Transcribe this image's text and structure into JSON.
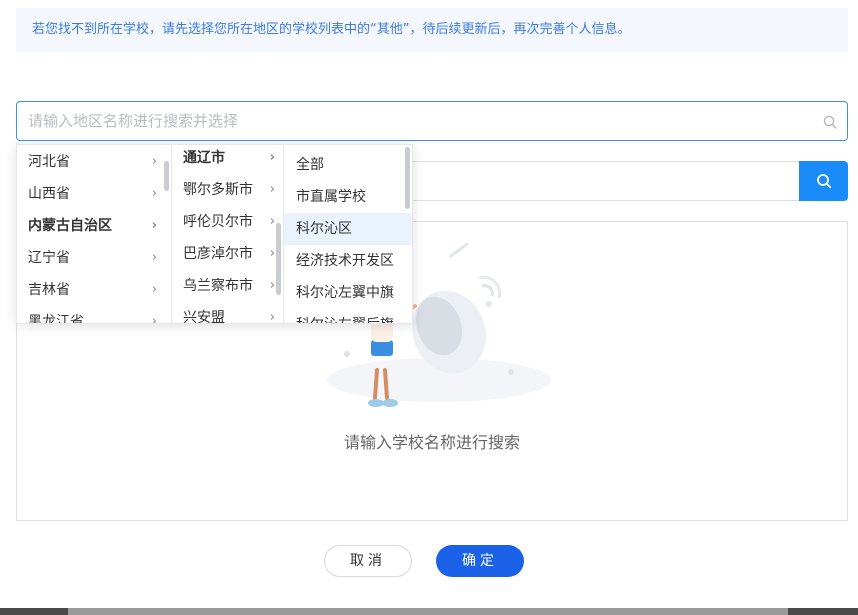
{
  "notice": "若您找不到所在学校，请先选择您所在地区的学校列表中的“其他”，待后续更新后，再次完善个人信息。",
  "region_select": {
    "placeholder": "请输入地区名称进行搜索并选择",
    "icon": "search-icon"
  },
  "school_search": {
    "placeholder": "",
    "button_icon": "search-icon"
  },
  "cascader": {
    "provinces": [
      {
        "label": "河北省",
        "arrow": "›"
      },
      {
        "label": "山西省",
        "arrow": "›"
      },
      {
        "label": "内蒙古自治区",
        "arrow": "›"
      },
      {
        "label": "辽宁省",
        "arrow": "›"
      },
      {
        "label": "吉林省",
        "arrow": "›"
      },
      {
        "label": "黑龙江省",
        "arrow": "›"
      }
    ],
    "selected_province": 2,
    "cities": [
      {
        "label": "通辽市",
        "arrow": "›"
      },
      {
        "label": "鄂尔多斯市",
        "arrow": "›"
      },
      {
        "label": "呼伦贝尔市",
        "arrow": "›"
      },
      {
        "label": "巴彦淖尔市",
        "arrow": "›"
      },
      {
        "label": "乌兰察布市",
        "arrow": "›"
      },
      {
        "label": "兴安盟",
        "arrow": "›"
      }
    ],
    "selected_city": 0,
    "districts": [
      {
        "label": "全部"
      },
      {
        "label": "市直属学校"
      },
      {
        "label": "科尔沁区"
      },
      {
        "label": "经济技术开发区"
      },
      {
        "label": "科尔沁左翼中旗"
      },
      {
        "label": "科尔沁左翼后旗"
      }
    ],
    "hover_district": 2
  },
  "results": {
    "empty_text": "请输入学校名称进行搜索"
  },
  "buttons": {
    "cancel": "取消",
    "confirm": "确定"
  },
  "colors": {
    "primary": "#1b62e8",
    "accent": "#1a8cfa",
    "notice_text": "#3c7be0",
    "highlight": "#eaf3fd"
  }
}
